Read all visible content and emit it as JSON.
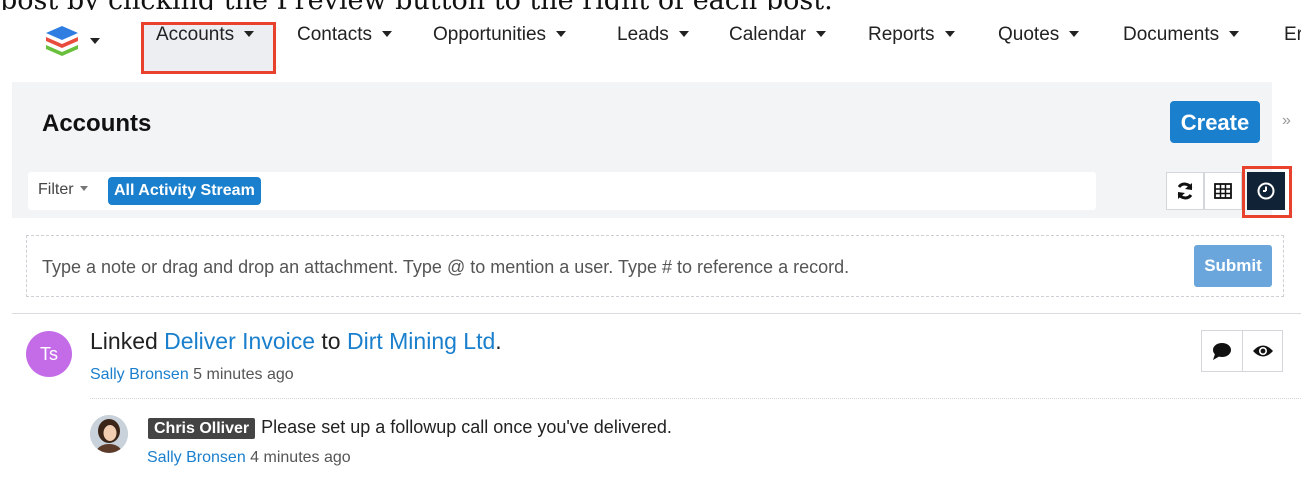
{
  "intro_text": "post by clicking the Preview button to the right of each post.",
  "nav": {
    "items": [
      "Accounts",
      "Contacts",
      "Opportunities",
      "Leads",
      "Calendar",
      "Reports",
      "Quotes",
      "Documents",
      "Er"
    ]
  },
  "header": {
    "title": "Accounts",
    "create_label": "Create",
    "expand_icon": "double-chevron-right-icon"
  },
  "filter": {
    "label": "Filter",
    "active_filter": "All Activity Stream"
  },
  "view_buttons": [
    "refresh-icon",
    "list-view-icon",
    "activity-stream-icon"
  ],
  "note": {
    "placeholder": "Type a note or drag and drop an attachment. Type @ to mention a user. Type # to reference a record.",
    "submit_label": "Submit"
  },
  "post": {
    "avatar_initials": "Ts",
    "verb": "Linked",
    "record": "Deliver Invoice",
    "connector": "to",
    "target": "Dirt Mining Ltd",
    "author": "Sally Bronsen",
    "time": "5 minutes ago"
  },
  "comment": {
    "mention": "Chris Olliver",
    "text": "Please set up a followup call once you've  delivered.",
    "author": "Sally Bronsen",
    "time": "4 minutes ago"
  },
  "colors": {
    "accent": "#1a7fcc",
    "highlight": "#e8412c",
    "avatar": "#c46ce8",
    "dark_button": "#0f2236"
  }
}
